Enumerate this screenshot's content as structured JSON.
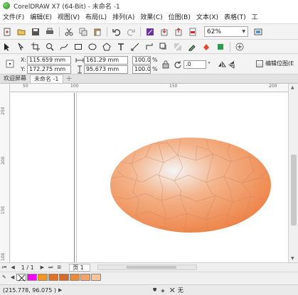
{
  "window": {
    "title": "CorelDRAW X7 (64-Bit) - 未命名 -1"
  },
  "menu": {
    "items": [
      "文件(F)",
      "编辑(E)",
      "视图(V)",
      "布局(L)",
      "排列(A)",
      "效果(C)",
      "位图(B)",
      "文本(X)",
      "表格(T)",
      "工"
    ]
  },
  "toolbar": {
    "zoom_value": "62%",
    "icons": [
      "new-file-icon",
      "open-file-icon",
      "save-icon",
      "print-icon",
      "cut-icon",
      "copy-icon",
      "paste-icon",
      "undo-icon",
      "redo-icon",
      "import-icon",
      "export-icon",
      "publish-pdf-icon",
      "welcome-screen-icon",
      "application-launcher-icon",
      "options-icon"
    ]
  },
  "properties": {
    "x_label": "X:",
    "x_value": "115.659 mm",
    "y_label": "Y:",
    "y_value": "172.275 mm",
    "width_value": "161.29 mm",
    "height_value": "95.673 mm",
    "scale_x": "100.0",
    "scale_y": "100.0",
    "percent": "%",
    "rotation_value": ".0",
    "degree_symbol": "°",
    "edit_bitmap_label": "编辑位图(E"
  },
  "tabs": {
    "items": [
      "欢迎屏幕",
      "未命名 -1"
    ],
    "add": "+"
  },
  "ruler": {
    "h_labels": [
      "50",
      "100",
      "150",
      "200"
    ],
    "v_labels": [
      "250",
      "200",
      "150",
      "100"
    ]
  },
  "document": {
    "page_count": "1 / 1",
    "page_tab": "页 1"
  },
  "palette": {
    "swatches": [
      "#ff00ff",
      "#f7941d",
      "#e07424",
      "#d76a2a",
      "#ec8a3a",
      "#f4a36a",
      "#f9c49b"
    ]
  },
  "status": {
    "coordinates": "(215.778, 96.075 )",
    "fill_none_label": "无"
  },
  "colors": {
    "ellipse_center": "#f5f5f5",
    "ellipse_mid": "#f4b38a",
    "ellipse_edge": "#ed7b3d"
  }
}
